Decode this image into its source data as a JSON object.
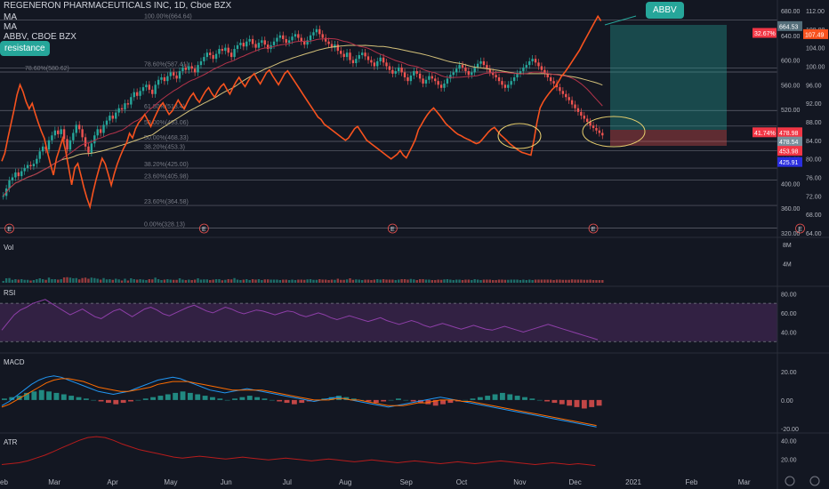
{
  "header": {
    "title": "REGENERON PHARMACEUTICALS INC, 1D, Cboe BZX",
    "ma1": "MA",
    "ma2": "MA",
    "compare": "ABBV, CBOE BZX"
  },
  "annotations": {
    "abbv_callout": "ABBV",
    "resistance": "resistance"
  },
  "colors": {
    "background": "#131722",
    "price_up": "#26a69a",
    "price_down": "#ef5350",
    "abbv_line": "#f7521e",
    "ma_fast": "#b2334a",
    "ma_slow": "#d4c17a",
    "rsi": "#8e3fa8",
    "macd": "#2196f3",
    "signal": "#ff6d00",
    "callout": "#26a69a",
    "ellipse": "#e8cf6e"
  },
  "chart_data": [
    {
      "type": "candlestick",
      "name": "price",
      "x_ticks": [
        "Feb",
        "Mar",
        "Apr",
        "May",
        "Jun",
        "Jul",
        "Aug",
        "Sep",
        "Oct",
        "Nov",
        "Dec",
        "2021",
        "Feb",
        "Mar"
      ],
      "x_tick_index": [
        0,
        19,
        40,
        61,
        81,
        103,
        124,
        146,
        166,
        187,
        207,
        228,
        249,
        268
      ],
      "ylim": [
        320,
        680
      ],
      "yticks": [
        "680.00",
        "640.00",
        "600.00",
        "560.00",
        "520.00",
        "480.00",
        "440.00",
        "400.00",
        "360.00",
        "320.00"
      ],
      "ytick_values": [
        680,
        640,
        600,
        560,
        520,
        480,
        440,
        400,
        360,
        320
      ],
      "abbv_axis": {
        "ylim": [
          64,
          112
        ],
        "ticks": [
          "112.00",
          "108.00",
          "104.00",
          "100.00",
          "96.00",
          "92.00",
          "88.00",
          "84.00",
          "80.00",
          "76.00",
          "72.00",
          "68.00",
          "64.00"
        ],
        "tick_values": [
          112,
          108,
          104,
          100,
          96,
          92,
          88,
          84,
          80,
          76,
          72,
          68,
          64
        ]
      },
      "closes": [
        380,
        392,
        405,
        410,
        418,
        412,
        420,
        425,
        430,
        428,
        432,
        440,
        452,
        460,
        455,
        470,
        478,
        486,
        480,
        488,
        472,
        455,
        470,
        482,
        495,
        488,
        475,
        460,
        450,
        465,
        478,
        488,
        482,
        495,
        502,
        510,
        505,
        515,
        522,
        520,
        530,
        528,
        540,
        548,
        542,
        550,
        556,
        560,
        552,
        545,
        560,
        568,
        572,
        566,
        574,
        580,
        575,
        570,
        582,
        588,
        584,
        590,
        586,
        580,
        592,
        598,
        605,
        612,
        608,
        602,
        610,
        618,
        615,
        620,
        612,
        605,
        618,
        624,
        628,
        622,
        630,
        634,
        626,
        620,
        628,
        632,
        625,
        618,
        624,
        630,
        636,
        640,
        634,
        628,
        632,
        638,
        642,
        636,
        630,
        625,
        632,
        640,
        645,
        650,
        642,
        636,
        630,
        626,
        620,
        625,
        615,
        610,
        605,
        612,
        600,
        595,
        602,
        608,
        612,
        606,
        600,
        596,
        590,
        598,
        604,
        596,
        590,
        584,
        578,
        582,
        588,
        580,
        572,
        566,
        575,
        582,
        578,
        570,
        562,
        568,
        574,
        570,
        566,
        560,
        555,
        562,
        570,
        576,
        580,
        586,
        592,
        588,
        582,
        576,
        580,
        588,
        594,
        598,
        592,
        586,
        580,
        576,
        572,
        566,
        560,
        555,
        560,
        566,
        572,
        578,
        582,
        588,
        592,
        598,
        602,
        596,
        590,
        584,
        578,
        572,
        566,
        562,
        556,
        550,
        545,
        540,
        535,
        528,
        522,
        516,
        510,
        505,
        500,
        494,
        490,
        486,
        482,
        478
      ],
      "abbv_closes": [
        79.5,
        81.2,
        84.4,
        87.5,
        90.5,
        93.8,
        96.0,
        94.5,
        92.3,
        90.8,
        92.0,
        89.8,
        87.8,
        86.0,
        84.4,
        81.5,
        78.9,
        76.5,
        80.1,
        82.2,
        84.4,
        81.7,
        78.1,
        74.4,
        78.1,
        79.0,
        76.5,
        73.8,
        71.5,
        69.6,
        72.8,
        75.5,
        77.9,
        80.1,
        78.9,
        76.7,
        74.3,
        76.8,
        78.9,
        80.6,
        82.2,
        83.4,
        85.5,
        84.5,
        86.5,
        87.8,
        88.6,
        89.6,
        88.3,
        87.0,
        88.6,
        90.0,
        91.3,
        92.1,
        90.8,
        89.6,
        90.3,
        91.5,
        92.7,
        91.6,
        90.8,
        92.2,
        93.4,
        94.2,
        93.0,
        92.2,
        93.5,
        94.6,
        95.4,
        94.2,
        93.3,
        94.6,
        95.6,
        96.2,
        95.0,
        94.0,
        95.4,
        96.6,
        97.6,
        96.5,
        95.6,
        96.8,
        97.8,
        98.4,
        97.2,
        96.2,
        97.4,
        98.6,
        99.2,
        98.0,
        97.0,
        96.0,
        97.2,
        98.4,
        99.0,
        98.0,
        97.0,
        96.0,
        95.0,
        94.0,
        93.0,
        92.0,
        91.0,
        90.0,
        89.0,
        88.5,
        87.5,
        87.0,
        86.5,
        86.0,
        85.5,
        85.0,
        84.5,
        84.0,
        84.5,
        85.5,
        86.5,
        87.0,
        86.0,
        85.0,
        84.0,
        83.5,
        83.0,
        82.5,
        82.0,
        81.5,
        81.0,
        80.5,
        80.0,
        80.5,
        81.0,
        81.8,
        80.8,
        80.2,
        81.5,
        82.8,
        84.2,
        86.3,
        87.4,
        88.6,
        89.6,
        90.4,
        91.0,
        90.2,
        89.4,
        88.5,
        87.6,
        87.0,
        86.4,
        85.8,
        85.3,
        85.0,
        84.6,
        84.3,
        84.0,
        83.6,
        83.3,
        83.5,
        84.2,
        85.0,
        85.8,
        86.4,
        86.8,
        86.0,
        85.2,
        84.6,
        84.0,
        83.3,
        82.8,
        82.3,
        81.8,
        81.4,
        81.2,
        81.0,
        80.8,
        84.2,
        88.0,
        91.0,
        92.3,
        93.3,
        94.2,
        95.0,
        95.6,
        96.6,
        97.8,
        98.6,
        99.5,
        100.5,
        101.5,
        102.5,
        103.5,
        104.8,
        106.0,
        107.2,
        108.4,
        109.6,
        110.8,
        109.8
      ],
      "volume_ylim": [
        0,
        8000000
      ],
      "volume_ticks": [
        "8M",
        "4M"
      ],
      "volume_tick_values": [
        8000000,
        4000000
      ],
      "fib_levels": [
        {
          "label": "100.00%(664.64)",
          "value": 664.64
        },
        {
          "label": "78.60%(587.41)",
          "value": 587.41
        },
        {
          "label": "78.60%(580.62)",
          "value": 580.62
        },
        {
          "label": "61.80%(518.4)",
          "value": 518.4
        },
        {
          "label": "50.00%(493.06)",
          "value": 493.06
        },
        {
          "label": "50.00%(468.33)",
          "value": 468.33
        },
        {
          "label": "38.20%(453.3)",
          "value": 453.3
        },
        {
          "label": "38.20%(425.00)",
          "value": 425.0
        },
        {
          "label": "23.60%(405.98)",
          "value": 405.98
        },
        {
          "label": "23.60%(364.58)",
          "value": 364.58
        },
        {
          "label": "0.00%(328.13)",
          "value": 328.13
        }
      ],
      "price_tags": [
        {
          "label": "32.67%",
          "value": 644,
          "color": "#f23645"
        },
        {
          "label": "664.53",
          "value": 655,
          "color": "#546e7a"
        },
        {
          "label": "107.49",
          "value": 642,
          "color": "#f7521e"
        },
        {
          "label": "41.74%",
          "value": 483,
          "color": "#f23645"
        },
        {
          "label": "478.98",
          "value": 483,
          "color": "#f23645"
        },
        {
          "label": "478.54",
          "value": 468,
          "color": "#78909c"
        },
        {
          "label": "453.98",
          "value": 453,
          "color": "#f23645"
        },
        {
          "label": "425.91",
          "value": 435,
          "color": "#2a2ee0"
        }
      ],
      "earnings_markers": [
        "E",
        "E",
        "E",
        "E",
        "E"
      ],
      "earnings_index": [
        2,
        66,
        128,
        194,
        262
      ]
    },
    {
      "type": "line",
      "name": "RSI",
      "ylim": [
        20,
        85
      ],
      "yticks": [
        "80.00",
        "60.00",
        "40.00"
      ],
      "ytick_values": [
        80,
        60,
        40
      ],
      "bands": [
        70,
        30
      ],
      "values": [
        42,
        50,
        58,
        63,
        66,
        70,
        72,
        74,
        70,
        66,
        62,
        58,
        61,
        64,
        60,
        56,
        54,
        58,
        62,
        64,
        60,
        56,
        60,
        64,
        66,
        63,
        59,
        57,
        60,
        63,
        66,
        68,
        65,
        62,
        60,
        63,
        66,
        64,
        61,
        59,
        61,
        63,
        62,
        60,
        58,
        60,
        62,
        61,
        58,
        56,
        58,
        60,
        58,
        55,
        53,
        55,
        57,
        55,
        53,
        51,
        53,
        55,
        52,
        50,
        48,
        50,
        52,
        50,
        47,
        45,
        47,
        49,
        47,
        45,
        43,
        45,
        47,
        45,
        43,
        42,
        44,
        46,
        44,
        42,
        40,
        42,
        44,
        46,
        48,
        46,
        44,
        42,
        40,
        38,
        36,
        34,
        32
      ]
    },
    {
      "type": "bar",
      "name": "MACD",
      "ylim": [
        -22,
        30
      ],
      "yticks": [
        "20.00",
        "0.00",
        "-20.00"
      ],
      "ytick_values": [
        20,
        0,
        -20
      ],
      "histogram": [
        1,
        2,
        3,
        5,
        6,
        7,
        6,
        5,
        4,
        3,
        2,
        1,
        0,
        -1,
        -2,
        -3,
        -2,
        -1,
        0,
        1,
        2,
        3,
        4,
        5,
        6,
        5,
        4,
        3,
        2,
        1,
        0,
        1,
        2,
        3,
        2,
        1,
        0,
        -1,
        -2,
        -3,
        -2,
        -1,
        0,
        1,
        2,
        3,
        2,
        1,
        0,
        -1,
        -2,
        -1,
        0,
        1,
        0,
        -1,
        -2,
        -3,
        -4,
        -3,
        -2,
        -1,
        0,
        1,
        2,
        3,
        4,
        5,
        4,
        3,
        2,
        1,
        0,
        -1,
        -2,
        -3,
        -4,
        -5,
        -6,
        -5,
        -4
      ],
      "macd": [
        -4,
        -1,
        3,
        7,
        11,
        14,
        16,
        17,
        16,
        14,
        12,
        10,
        8,
        6,
        5,
        4,
        5,
        6,
        8,
        10,
        12,
        14,
        15,
        16,
        15,
        13,
        11,
        9,
        7,
        6,
        5,
        6,
        7,
        8,
        7,
        6,
        5,
        4,
        3,
        2,
        1,
        0,
        -1,
        0,
        1,
        2,
        1,
        0,
        -1,
        -2,
        -3,
        -4,
        -5,
        -4,
        -3,
        -2,
        -1,
        0,
        1,
        2,
        1,
        0,
        -1,
        -2,
        -3,
        -4,
        -5,
        -6,
        -7,
        -8,
        -9,
        -10,
        -11,
        -12,
        -13,
        -14,
        -15,
        -16,
        -17,
        -18,
        -19
      ],
      "signal": [
        -5,
        -3,
        0,
        3,
        6,
        9,
        12,
        14,
        15,
        15,
        14,
        13,
        11,
        9,
        8,
        7,
        6,
        6,
        7,
        8,
        9,
        11,
        12,
        13,
        13,
        13,
        12,
        11,
        10,
        9,
        8,
        7,
        7,
        7,
        7,
        7,
        6,
        5,
        4,
        3,
        2,
        1,
        0,
        0,
        0,
        1,
        1,
        0,
        0,
        -1,
        -2,
        -3,
        -4,
        -4,
        -4,
        -3,
        -2,
        -2,
        -1,
        0,
        0,
        0,
        -1,
        -1,
        -2,
        -3,
        -4,
        -5,
        -6,
        -7,
        -8,
        -9,
        -10,
        -11,
        -12,
        -13,
        -14,
        -15,
        -16,
        -17,
        -18
      ]
    },
    {
      "type": "line",
      "name": "ATR",
      "ylim": [
        5,
        45
      ],
      "yticks": [
        "40.00",
        "20.00"
      ],
      "ytick_values": [
        40,
        20
      ],
      "values": [
        14,
        15,
        16,
        18,
        21,
        24,
        28,
        32,
        36,
        40,
        43,
        44,
        43,
        40,
        36,
        33,
        30,
        28,
        26,
        24,
        22,
        21,
        22,
        23,
        22,
        21,
        20,
        21,
        22,
        21,
        20,
        19,
        20,
        21,
        20,
        19,
        18,
        19,
        20,
        19,
        18,
        17,
        18,
        19,
        18,
        17,
        16,
        17,
        18,
        17,
        16,
        15,
        16,
        17,
        16,
        15,
        16,
        17,
        18,
        17,
        16,
        15,
        14,
        15,
        16,
        15,
        14,
        15,
        14,
        13
      ]
    }
  ]
}
